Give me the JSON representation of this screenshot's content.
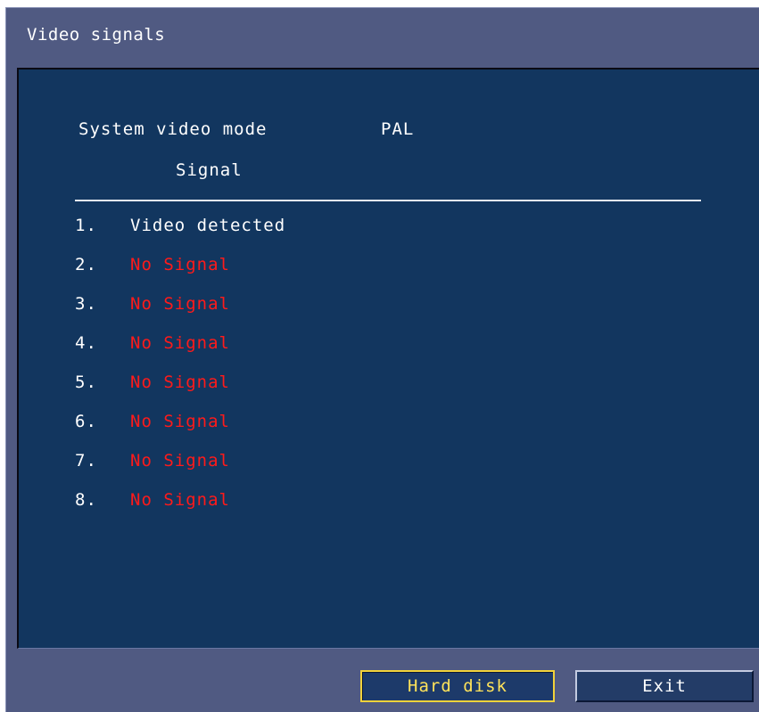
{
  "window": {
    "title": "Video signals"
  },
  "panel": {
    "system_video_mode_label": "System video mode",
    "system_video_mode_value": "PAL",
    "signal_header": "Signal"
  },
  "signals": [
    {
      "number": "1.",
      "status": "Video detected",
      "color": "#ffffff"
    },
    {
      "number": "2.",
      "status": "No Signal",
      "color": "#ff1a1a"
    },
    {
      "number": "3.",
      "status": "No Signal",
      "color": "#ff1a1a"
    },
    {
      "number": "4.",
      "status": "No Signal",
      "color": "#ff1a1a"
    },
    {
      "number": "5.",
      "status": "No Signal",
      "color": "#ff1a1a"
    },
    {
      "number": "6.",
      "status": "No Signal",
      "color": "#ff1a1a"
    },
    {
      "number": "7.",
      "status": "No Signal",
      "color": "#ff1a1a"
    },
    {
      "number": "8.",
      "status": "No Signal",
      "color": "#ff1a1a"
    }
  ],
  "buttons": {
    "hard_disk": "Hard disk",
    "exit": "Exit"
  },
  "colors": {
    "frame_bg": "#505a82",
    "panel_bg": "#12365f",
    "focus_border": "#f2d23a",
    "focus_text": "#ffe35a",
    "no_signal": "#ff1a1a"
  }
}
